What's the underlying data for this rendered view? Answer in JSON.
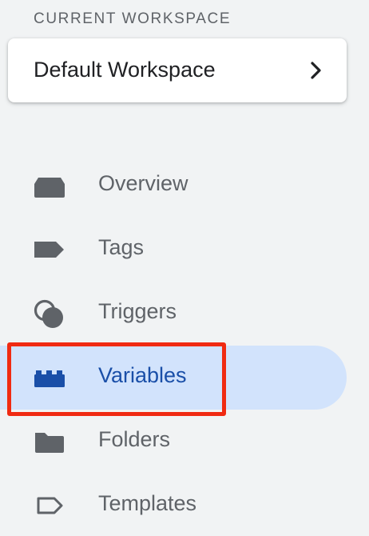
{
  "workspace": {
    "section_label": "CURRENT WORKSPACE",
    "name": "Default Workspace"
  },
  "nav": {
    "items": [
      {
        "label": "Overview",
        "icon": "overview-icon"
      },
      {
        "label": "Tags",
        "icon": "tag-icon"
      },
      {
        "label": "Triggers",
        "icon": "trigger-icon"
      },
      {
        "label": "Variables",
        "icon": "variables-icon",
        "active": true
      },
      {
        "label": "Folders",
        "icon": "folder-icon"
      },
      {
        "label": "Templates",
        "icon": "template-icon"
      }
    ]
  },
  "colors": {
    "background": "#f1f3f4",
    "active_background": "#d2e3fc",
    "active_text": "#1a4fa8",
    "icon_gray": "#5f6368",
    "annotation_red": "#f02a12"
  }
}
